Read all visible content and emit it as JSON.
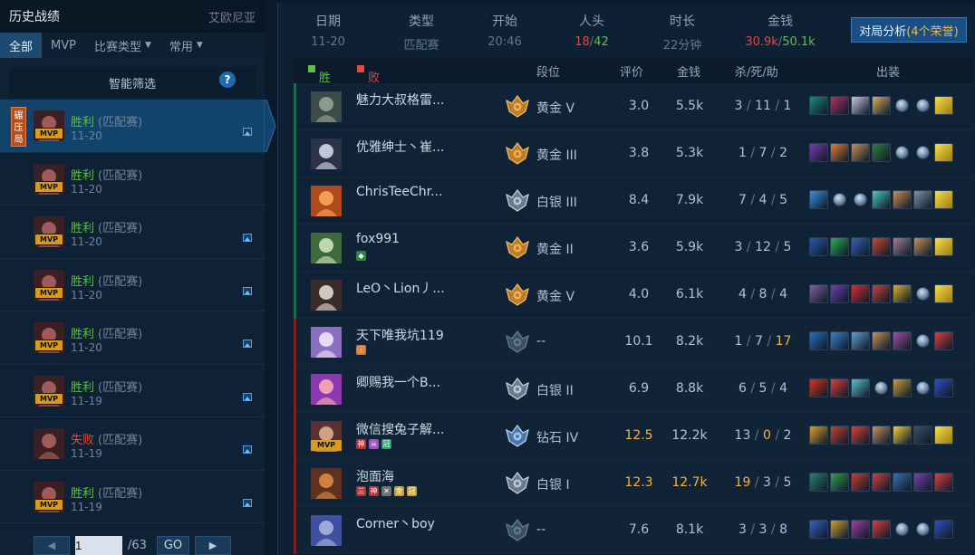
{
  "left": {
    "title": "历史战绩",
    "server": "艾欧尼亚",
    "tabs": [
      {
        "label": "全部",
        "active": true,
        "dropdown": false
      },
      {
        "label": "MVP",
        "active": false,
        "dropdown": false
      },
      {
        "label": "比赛类型",
        "active": false,
        "dropdown": true
      },
      {
        "label": "常用",
        "active": false,
        "dropdown": true
      }
    ],
    "smart_filter": "智能筛选",
    "help": "?",
    "matches": [
      {
        "tag": "碾压局",
        "result": "胜利",
        "win": true,
        "mode": "(匹配赛)",
        "date": "11-20",
        "mvp": "MVP",
        "has_pic": true,
        "active": true
      },
      {
        "tag": "",
        "result": "胜利",
        "win": true,
        "mode": "(匹配赛)",
        "date": "11-20",
        "mvp": "MVP",
        "has_pic": false,
        "active": false
      },
      {
        "tag": "",
        "result": "胜利",
        "win": true,
        "mode": "(匹配赛)",
        "date": "11-20",
        "mvp": "MVP",
        "has_pic": true,
        "active": false
      },
      {
        "tag": "",
        "result": "胜利",
        "win": true,
        "mode": "(匹配赛)",
        "date": "11-20",
        "mvp": "MVP",
        "has_pic": true,
        "active": false
      },
      {
        "tag": "",
        "result": "胜利",
        "win": true,
        "mode": "(匹配赛)",
        "date": "11-20",
        "mvp": "MVP",
        "has_pic": true,
        "active": false
      },
      {
        "tag": "",
        "result": "胜利",
        "win": true,
        "mode": "(匹配赛)",
        "date": "11-19",
        "mvp": "MVP",
        "has_pic": true,
        "active": false
      },
      {
        "tag": "",
        "result": "失败",
        "win": false,
        "mode": "(匹配赛)",
        "date": "11-19",
        "mvp": "",
        "has_pic": true,
        "active": false
      },
      {
        "tag": "",
        "result": "胜利",
        "win": true,
        "mode": "(匹配赛)",
        "date": "11-19",
        "mvp": "MVP",
        "has_pic": true,
        "active": false
      }
    ],
    "pager": {
      "page": "1",
      "total": "/63",
      "go": "GO"
    }
  },
  "summary": {
    "date_h": "日期",
    "date": "11-20",
    "type_h": "类型",
    "type": "匹配赛",
    "start_h": "开始",
    "start": "20:46",
    "kills_h": "人头",
    "kills_a": "18",
    "kills_b": "42",
    "kills_sep": "/",
    "dur_h": "时长",
    "dur": "22分钟",
    "gold_h": "金钱",
    "gold_a": "30.9k",
    "gold_b": "50.1k",
    "gold_sep": "/",
    "analysis": "对局分析",
    "honor": "(4个荣誉)"
  },
  "table": {
    "win_label": "胜方",
    "lose_label": "败方",
    "col_rank": "段位",
    "col_rate": "评价",
    "col_gold": "金钱",
    "col_kda": "杀/死/助",
    "col_items": "出装",
    "win_color": "#5fbf48",
    "lose_color": "#e24a3a",
    "players": [
      {
        "name": "魅力大叔格雷...",
        "rank": "黄金 V",
        "rank_tier": "gold",
        "rate": "3.0",
        "gold": "5.5k",
        "k": "3",
        "d": "11",
        "a": "1",
        "side": "lose",
        "avatar": [
          "#3d4a4a",
          "#8a9a8c"
        ],
        "badges": [],
        "items": [
          "#1c8a7a",
          "#b43060",
          "#c8c8d8",
          "#d8b060",
          "trk",
          "trk",
          "ward"
        ]
      },
      {
        "name": "优雅绅士丶崔...",
        "rank": "黄金 III",
        "rank_tier": "gold",
        "rate": "3.8",
        "gold": "5.3k",
        "k": "1",
        "d": "7",
        "a": "2",
        "side": "lose",
        "avatar": [
          "#2a3446",
          "#c0c8d8"
        ],
        "badges": [],
        "items": [
          "#7a3ab0",
          "#e08030",
          "#c89058",
          "#2a8040",
          "trk",
          "trk",
          "ward"
        ]
      },
      {
        "name": "ChrisTeeChr...",
        "rank": "白银 III",
        "rank_tier": "silver",
        "rate": "8.4",
        "gold": "7.9k",
        "k": "7",
        "d": "4",
        "a": "5",
        "side": "lose",
        "avatar": [
          "#b04a1c",
          "#f0a050"
        ],
        "badges": [],
        "items": [
          "#3a90e0",
          "trk",
          "trk",
          "#50c8c0",
          "#c89058",
          "#8090a8",
          "ward"
        ]
      },
      {
        "name": "fox991",
        "rank": "黄金 II",
        "rank_tier": "gold",
        "rate": "3.6",
        "gold": "5.9k",
        "k": "3",
        "d": "12",
        "a": "5",
        "side": "lose",
        "avatar": [
          "#3e6a3e",
          "#c0d8b0"
        ],
        "badges": [
          {
            "t": "◆",
            "c": "#2d8a3a"
          }
        ],
        "items": [
          "#2a5aa8",
          "#2ab050",
          "#3a60b0",
          "#c84a30",
          "#a08090",
          "#c89058",
          "ward"
        ]
      },
      {
        "name": "LeO丶Lion丿...",
        "rank": "黄金 V",
        "rank_tier": "gold",
        "rate": "4.0",
        "gold": "6.1k",
        "k": "4",
        "d": "8",
        "a": "4",
        "side": "lose",
        "avatar": [
          "#3a2a2a",
          "#d0c8c0"
        ],
        "badges": [],
        "items": [
          "#8060a0",
          "#7040b0",
          "#d83030",
          "#c84040",
          "#d8b030",
          "trk",
          "ward"
        ]
      },
      {
        "name": "天下唯我坑119",
        "rank": "--",
        "rank_tier": "none",
        "rate": "10.1",
        "gold": "8.2k",
        "k": "1",
        "d": "7",
        "a": "17",
        "side": "win",
        "avatar": [
          "#8a70c0",
          "#e8d8f0"
        ],
        "badges": [
          {
            "t": "ⓢ",
            "c": "#d87a20"
          }
        ],
        "items": [
          "#2a70c0",
          "#3a80d0",
          "#60a0d0",
          "#c89058",
          "#a050a0",
          "trk",
          "#d84040"
        ]
      },
      {
        "name": "卿赐我一个B...",
        "rank": "白银 II",
        "rank_tier": "silver",
        "rate": "6.9",
        "gold": "8.8k",
        "k": "6",
        "d": "5",
        "a": "4",
        "side": "win",
        "avatar": [
          "#8a3ab0",
          "#f0a0b0"
        ],
        "badges": [],
        "items": [
          "#d83020",
          "#d84040",
          "#60c0d0",
          "trk",
          "#c8a040",
          "trk",
          "#3050c0"
        ]
      },
      {
        "name": "微信搜兔子解...",
        "rank": "钻石 IV",
        "rank_tier": "diamond",
        "rate": "12.5",
        "gold": "12.2k",
        "k": "13",
        "d": "0",
        "a": "2",
        "side": "win",
        "mvp": true,
        "avatar": [
          "#5a3030",
          "#d0a080"
        ],
        "badges": [
          {
            "t": "神",
            "c": "#c03030"
          },
          {
            "t": "☠",
            "c": "#a050c0"
          },
          {
            "t": "冠",
            "c": "#2aa070"
          }
        ],
        "items": [
          "#d8a030",
          "#c84030",
          "#d84040",
          "#c89058",
          "#f0d040",
          "#405060",
          "ward"
        ]
      },
      {
        "name": "泡面海",
        "rank": "白银 I",
        "rank_tier": "silver",
        "rate": "12.3",
        "gold": "12.7k",
        "k": "19",
        "d": "3",
        "a": "5",
        "side": "win",
        "avatar": [
          "#603020",
          "#d08040"
        ],
        "badges": [
          {
            "t": "三",
            "c": "#c03030"
          },
          {
            "t": "神",
            "c": "#c03030"
          },
          {
            "t": "✕",
            "c": "#707070"
          },
          {
            "t": "金",
            "c": "#d0a020"
          },
          {
            "t": "冠",
            "c": "#d0a020"
          }
        ],
        "items": [
          "#2a8070",
          "#30a050",
          "#c84030",
          "#d04040",
          "#3a70b0",
          "#7a40b0",
          "#d84040"
        ]
      },
      {
        "name": "Corner丶boy",
        "rank": "--",
        "rank_tier": "none",
        "rate": "7.6",
        "gold": "8.1k",
        "k": "3",
        "d": "3",
        "a": "8",
        "side": "win",
        "avatar": [
          "#4050a0",
          "#a0a8d8"
        ],
        "badges": [],
        "items": [
          "#3a60c0",
          "#d0a030",
          "#a040a0",
          "#d84040",
          "trk",
          "trk",
          "#3050c0"
        ]
      }
    ]
  }
}
